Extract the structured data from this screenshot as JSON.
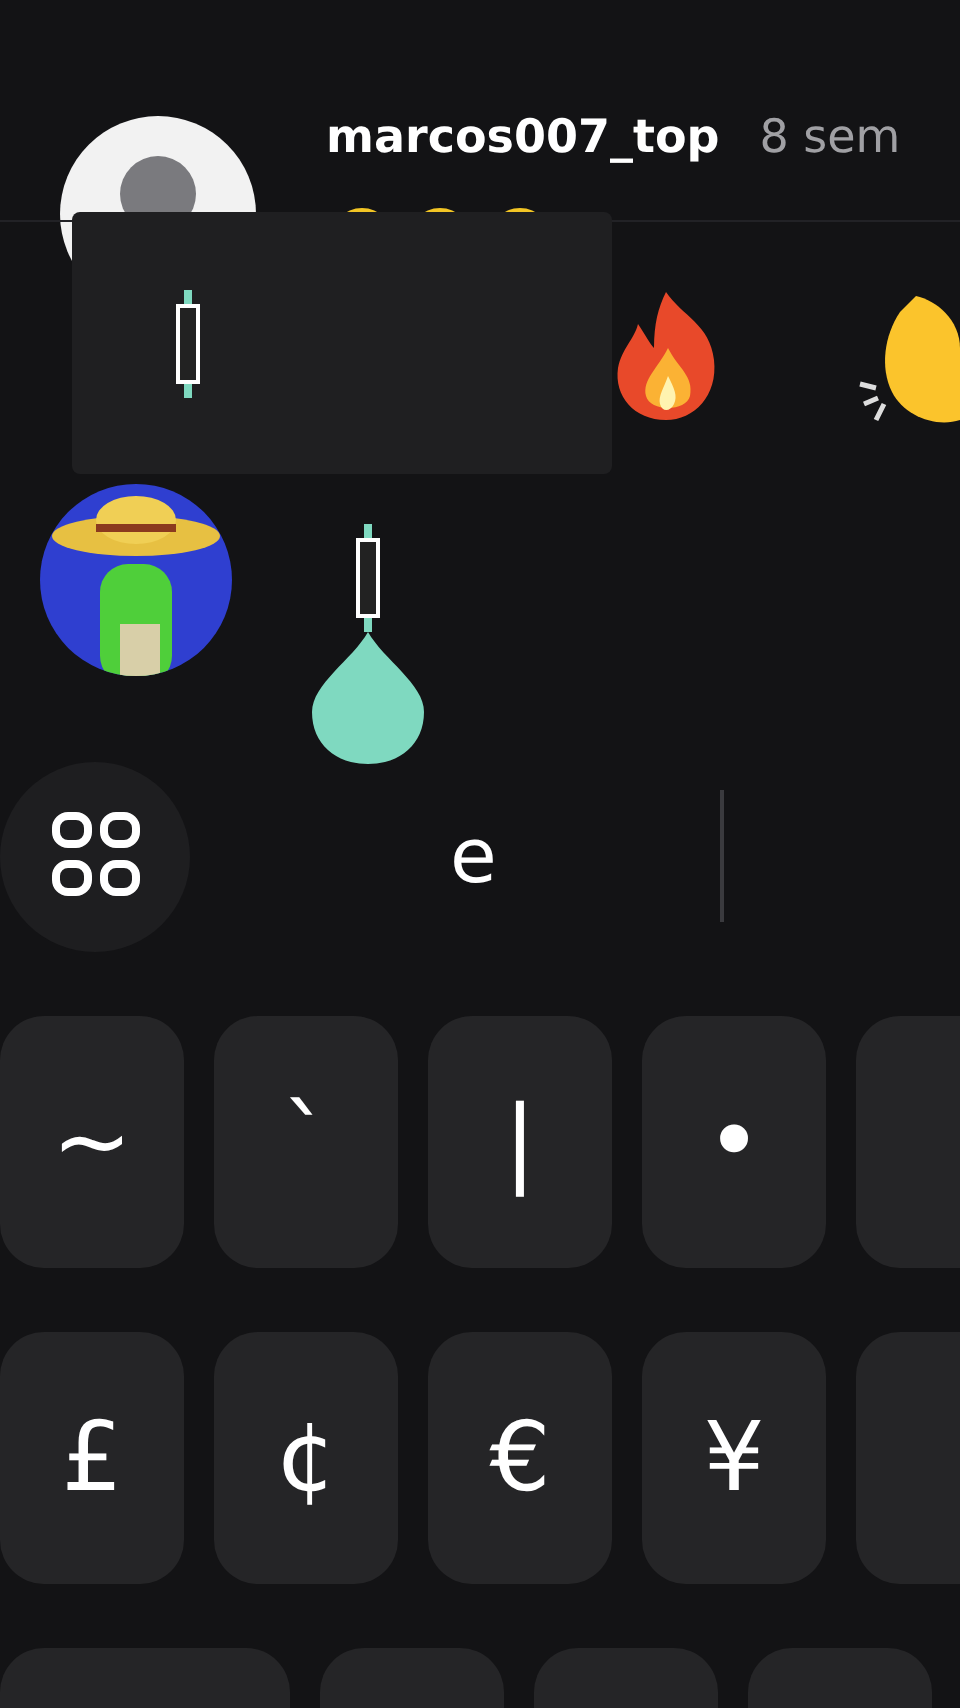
{
  "comment": {
    "username": "marcos007_top",
    "time": "8 sem"
  },
  "keyboard": {
    "suggestion": "e",
    "rows": [
      [
        "~",
        "`",
        "|",
        "•"
      ],
      [
        "£",
        "¢",
        "€",
        "¥"
      ]
    ]
  }
}
